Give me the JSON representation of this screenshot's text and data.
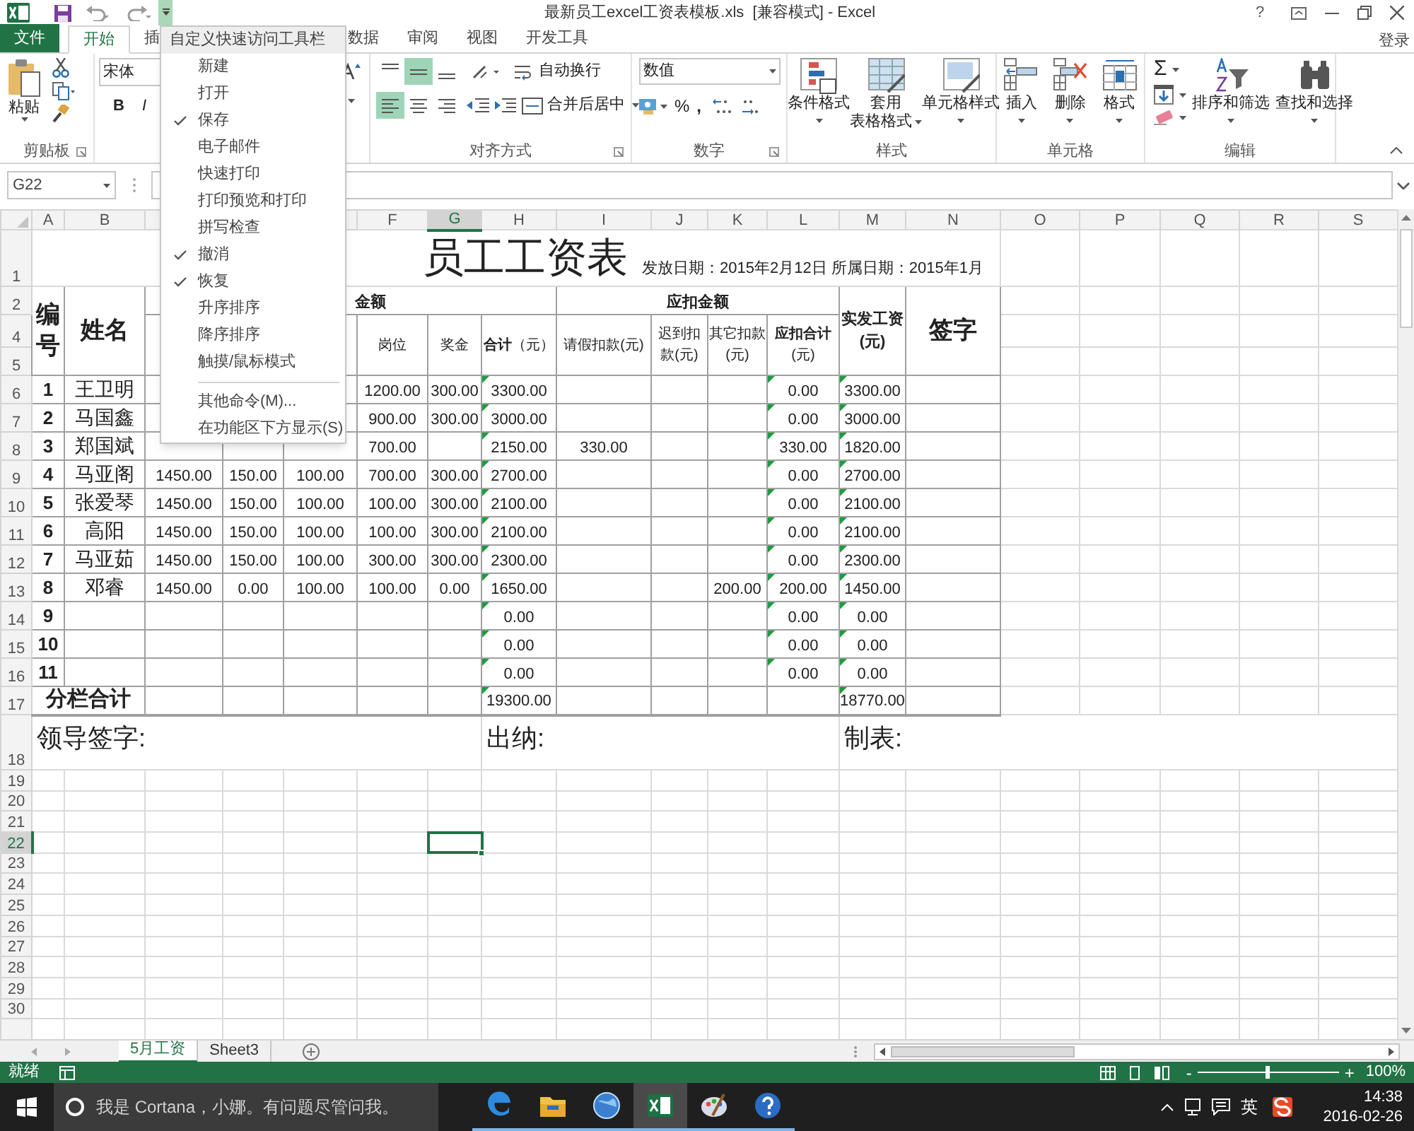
{
  "title_bar": {
    "title": "最新员工excel工资表模板.xls  [兼容模式] - Excel",
    "help": "?"
  },
  "quick_access": {
    "customize_open": true
  },
  "tabs": [
    {
      "label": "文件",
      "kind": "file",
      "selected": false
    },
    {
      "label": "开始",
      "kind": "tab",
      "selected": true
    },
    {
      "label": "插",
      "kind": "tab",
      "selected": false
    },
    {
      "label": "数据",
      "kind": "tab",
      "selected": false
    },
    {
      "label": "审阅",
      "kind": "tab",
      "selected": false
    },
    {
      "label": "视图",
      "kind": "tab",
      "selected": false
    },
    {
      "label": "开发工具",
      "kind": "tab",
      "selected": false
    }
  ],
  "account": "登录",
  "ribbon": {
    "clipboard": {
      "paste": "粘贴",
      "label": "剪贴板"
    },
    "font": {
      "name": "宋体",
      "bold": "B",
      "italic": "I"
    },
    "alignment": {
      "vertical": [
        {
          "kind": "top",
          "selected": false
        },
        {
          "kind": "middle",
          "selected": true
        },
        {
          "kind": "bottom",
          "selected": false
        }
      ],
      "horizontal": [
        {
          "kind": "left",
          "selected": true
        },
        {
          "kind": "center",
          "selected": false
        },
        {
          "kind": "right",
          "selected": false
        }
      ],
      "wrap": "自动换行",
      "merge": "合并后居中",
      "label": "对齐方式"
    },
    "number": {
      "format": "数值",
      "percent": "%",
      "comma": ",",
      "label": "数字"
    },
    "styles": {
      "buttons": [
        {
          "kind": "conditional",
          "label": "条件格式"
        },
        {
          "kind": "table",
          "label": "套用",
          "label2": "表格格式"
        },
        {
          "kind": "cell",
          "label": "单元格样式"
        }
      ],
      "label": "样式"
    },
    "cells": {
      "buttons": [
        {
          "kind": "insert",
          "label": "插入"
        },
        {
          "kind": "delete",
          "label": "删除"
        },
        {
          "kind": "format",
          "label": "格式"
        }
      ],
      "label": "单元格"
    },
    "editing": {
      "sum": "Σ",
      "buttons": [
        {
          "kind": "sort",
          "label": "排序和筛选"
        },
        {
          "kind": "find",
          "label": "查找和选择"
        }
      ],
      "label": "编辑"
    }
  },
  "formula_bar": {
    "name_box": "G22"
  },
  "sheet": {
    "column_headers": [
      {
        "label": "A",
        "selected": false
      },
      {
        "label": "B",
        "selected": false
      },
      {
        "label": "F",
        "selected": false
      },
      {
        "label": "G",
        "selected": true
      },
      {
        "label": "H",
        "selected": false
      },
      {
        "label": "I",
        "selected": false
      },
      {
        "label": "J",
        "selected": false
      },
      {
        "label": "K",
        "selected": false
      },
      {
        "label": "L",
        "selected": false
      },
      {
        "label": "M",
        "selected": false
      },
      {
        "label": "N",
        "selected": false
      },
      {
        "label": "O",
        "selected": false
      },
      {
        "label": "P",
        "selected": false
      },
      {
        "label": "Q",
        "selected": false
      },
      {
        "label": "R",
        "selected": false
      },
      {
        "label": "S",
        "selected": false
      }
    ],
    "row_headers": [
      {
        "label": "1",
        "selected": false
      },
      {
        "label": "2",
        "selected": false
      },
      {
        "label": "4",
        "selected": false
      },
      {
        "label": "5",
        "selected": false
      },
      {
        "label": "6",
        "selected": false
      },
      {
        "label": "7",
        "selected": false
      },
      {
        "label": "8",
        "selected": false
      },
      {
        "label": "9",
        "selected": false
      },
      {
        "label": "10",
        "selected": false
      },
      {
        "label": "11",
        "selected": false
      },
      {
        "label": "12",
        "selected": false
      },
      {
        "label": "13",
        "selected": false
      },
      {
        "label": "14",
        "selected": false
      },
      {
        "label": "15",
        "selected": false
      },
      {
        "label": "16",
        "selected": false
      },
      {
        "label": "17",
        "selected": false
      },
      {
        "label": "18",
        "selected": false
      },
      {
        "label": "19",
        "selected": false
      },
      {
        "label": "20",
        "selected": false
      },
      {
        "label": "21",
        "selected": false
      },
      {
        "label": "22",
        "selected": true
      },
      {
        "label": "23",
        "selected": false
      },
      {
        "label": "24",
        "selected": false
      },
      {
        "label": "25",
        "selected": false
      },
      {
        "label": "26",
        "selected": false
      },
      {
        "label": "27",
        "selected": false
      },
      {
        "label": "28",
        "selected": false
      },
      {
        "label": "29",
        "selected": false
      },
      {
        "label": "30",
        "selected": false
      }
    ],
    "title": "员工工资表",
    "dates": "发放日期：2015年2月12日 所属日期：2015年1月",
    "header": {
      "no": "编号",
      "name": "姓名",
      "gross": "金额",
      "deduct": "应扣金额",
      "net": "实发工资(元)",
      "sign": "签字",
      "columns": [
        "岗位",
        "奖金",
        "**合计**（元）",
        "请假扣款(元)",
        "迟到扣款(元)",
        "其它扣款(元)",
        "**应扣合计**(元)"
      ]
    },
    "rows": [
      {
        "cells": [
          "1",
          "王卫明",
          null,
          null,
          null,
          "1200.00",
          "300.00",
          {
            "text": "3300.00",
            "flagged": true
          },
          null,
          null,
          null,
          {
            "text": "0.00",
            "flagged": true
          },
          {
            "text": "3300.00",
            "flagged": true
          }
        ]
      },
      {
        "cells": [
          "2",
          "马国鑫",
          null,
          null,
          null,
          "900.00",
          "300.00",
          {
            "text": "3000.00",
            "flagged": true
          },
          null,
          null,
          null,
          {
            "text": "0.00",
            "flagged": true
          },
          {
            "text": "3000.00",
            "flagged": true
          }
        ]
      },
      {
        "cells": [
          "3",
          "郑国斌",
          null,
          null,
          null,
          "700.00",
          null,
          {
            "text": "2150.00",
            "flagged": true
          },
          "330.00",
          null,
          null,
          {
            "text": "330.00",
            "flagged": true
          },
          {
            "text": "1820.00",
            "flagged": true
          }
        ]
      },
      {
        "cells": [
          "4",
          "马亚阁",
          "1450.00",
          "150.00",
          "100.00",
          "700.00",
          "300.00",
          {
            "text": "2700.00",
            "flagged": true
          },
          null,
          null,
          null,
          {
            "text": "0.00",
            "flagged": true
          },
          {
            "text": "2700.00",
            "flagged": true
          }
        ]
      },
      {
        "cells": [
          "5",
          "张爱琴",
          "1450.00",
          "150.00",
          "100.00",
          "100.00",
          "300.00",
          {
            "text": "2100.00",
            "flagged": true
          },
          null,
          null,
          null,
          {
            "text": "0.00",
            "flagged": true
          },
          {
            "text": "2100.00",
            "flagged": true
          }
        ]
      },
      {
        "cells": [
          "6",
          "高阳",
          "1450.00",
          "150.00",
          "100.00",
          "100.00",
          "300.00",
          {
            "text": "2100.00",
            "flagged": true
          },
          null,
          null,
          null,
          {
            "text": "0.00",
            "flagged": true
          },
          {
            "text": "2100.00",
            "flagged": true
          }
        ]
      },
      {
        "cells": [
          "7",
          "马亚茹",
          "1450.00",
          "150.00",
          "100.00",
          "300.00",
          "300.00",
          {
            "text": "2300.00",
            "flagged": true
          },
          null,
          null,
          null,
          {
            "text": "0.00",
            "flagged": true
          },
          {
            "text": "2300.00",
            "flagged": true
          }
        ]
      },
      {
        "cells": [
          "8",
          "邓睿",
          "1450.00",
          "0.00",
          "100.00",
          "100.00",
          "0.00",
          {
            "text": "1650.00",
            "flagged": true
          },
          null,
          null,
          "200.00",
          {
            "text": "200.00",
            "flagged": true
          },
          {
            "text": "1450.00",
            "flagged": true
          }
        ]
      },
      {
        "cells": [
          "9",
          null,
          null,
          null,
          null,
          null,
          null,
          {
            "text": "0.00",
            "flagged": true
          },
          null,
          null,
          null,
          {
            "text": "0.00",
            "flagged": true
          },
          {
            "text": "0.00",
            "flagged": true
          }
        ]
      },
      {
        "cells": [
          "10",
          null,
          null,
          null,
          null,
          null,
          null,
          {
            "text": "0.00",
            "flagged": true
          },
          null,
          null,
          null,
          {
            "text": "0.00",
            "flagged": true
          },
          {
            "text": "0.00",
            "flagged": true
          }
        ]
      },
      {
        "cells": [
          "11",
          null,
          null,
          null,
          null,
          null,
          null,
          {
            "text": "0.00",
            "flagged": true
          },
          null,
          null,
          null,
          {
            "text": "0.00",
            "flagged": true
          },
          {
            "text": "0.00",
            "flagged": true
          }
        ]
      }
    ],
    "total": {
      "label": "分栏合计",
      "cells": [
        null,
        null,
        null,
        null,
        null,
        {
          "text": "19300.00",
          "flagged": true
        },
        null,
        null,
        null,
        null,
        {
          "text": "18770.00",
          "flagged": true
        }
      ]
    },
    "footer": {
      "leader": "领导签字:",
      "cashier": "出纳:",
      "preparer": "制表:"
    }
  },
  "menu": {
    "title": "自定义快速访问工具栏",
    "items": [
      {
        "label": "新建",
        "checked": false
      },
      {
        "label": "打开",
        "checked": false
      },
      {
        "label": "保存",
        "checked": true
      },
      {
        "label": "电子邮件",
        "checked": false
      },
      {
        "label": "快速打印",
        "checked": false
      },
      {
        "label": "打印预览和打印",
        "checked": false
      },
      {
        "label": "拼写检查",
        "checked": false
      },
      {
        "label": "撤消",
        "checked": true
      },
      {
        "label": "恢复",
        "checked": true
      },
      {
        "label": "升序排序",
        "checked": false
      },
      {
        "label": "降序排序",
        "checked": false
      },
      {
        "label": "触摸/鼠标模式",
        "checked": false
      }
    ],
    "more": [
      "其他命令(M)...",
      "在功能区下方显示(S)"
    ]
  },
  "sheet_tabs": [
    {
      "label": "5月工资",
      "selected": true
    },
    {
      "label": "Sheet3",
      "selected": false
    }
  ],
  "status_bar": {
    "state": "就绪",
    "zoom": {
      "zoom_out": "-",
      "zoom_in": "+",
      "level": 0.5,
      "reading": "100%"
    }
  },
  "taskbar": {
    "search_placeholder": "我是 Cortana，小娜。有问题尽管问我。",
    "apps": [
      {
        "kind": "edge",
        "active": false
      },
      {
        "kind": "folder",
        "active": false
      },
      {
        "kind": "globe",
        "active": false
      },
      {
        "kind": "excel",
        "active": true
      },
      {
        "kind": "paint",
        "active": false
      },
      {
        "kind": "help",
        "active": false
      }
    ],
    "ime": "英",
    "time": "14:38",
    "date": "2016-02-26"
  }
}
